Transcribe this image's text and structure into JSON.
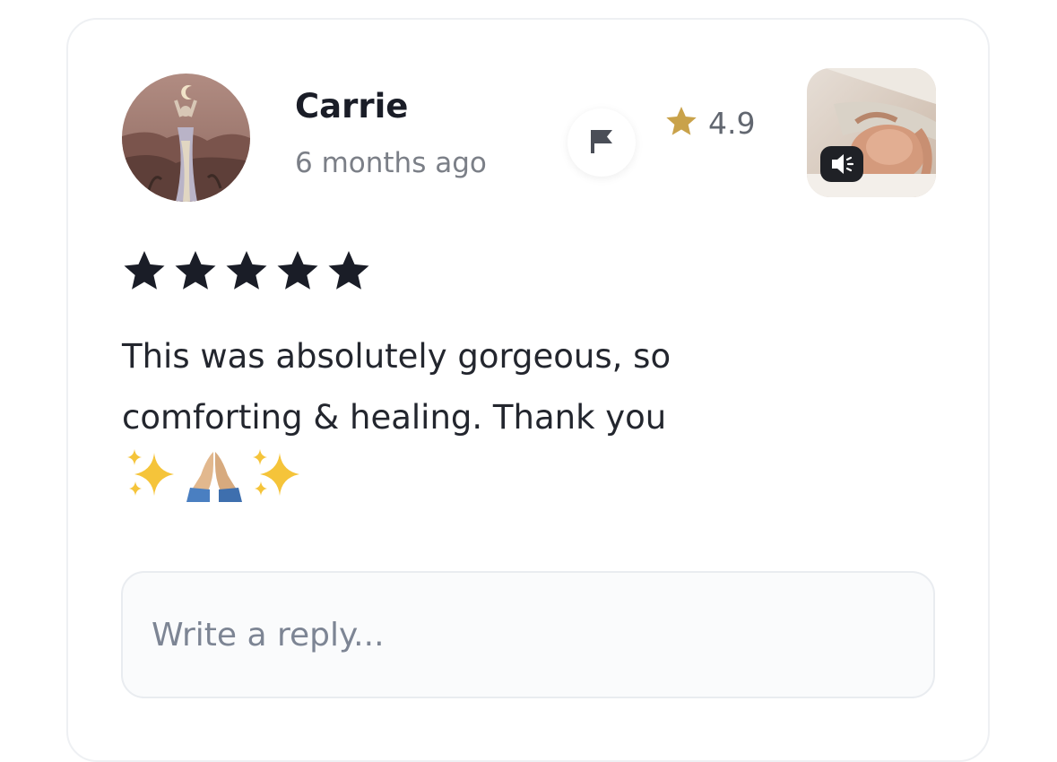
{
  "review": {
    "author": "Carrie",
    "time_ago": "6 months ago",
    "rating_value": "4.9",
    "stars": 5,
    "text_lines": [
      "This was absolutely gorgeous, so",
      "comforting & healing. Thank you"
    ],
    "emojis": [
      "sparkles",
      "folded-hands",
      "sparkles"
    ]
  },
  "reply": {
    "placeholder": "Write a reply..."
  },
  "icons": {
    "flag": "flag-icon",
    "rating_star": "star-icon",
    "sound": "speaker-icon"
  },
  "colors": {
    "rating_star": "#c9a24a",
    "review_stars": "#1a1d27",
    "text": "#23262e",
    "muted": "#7b7f87"
  }
}
